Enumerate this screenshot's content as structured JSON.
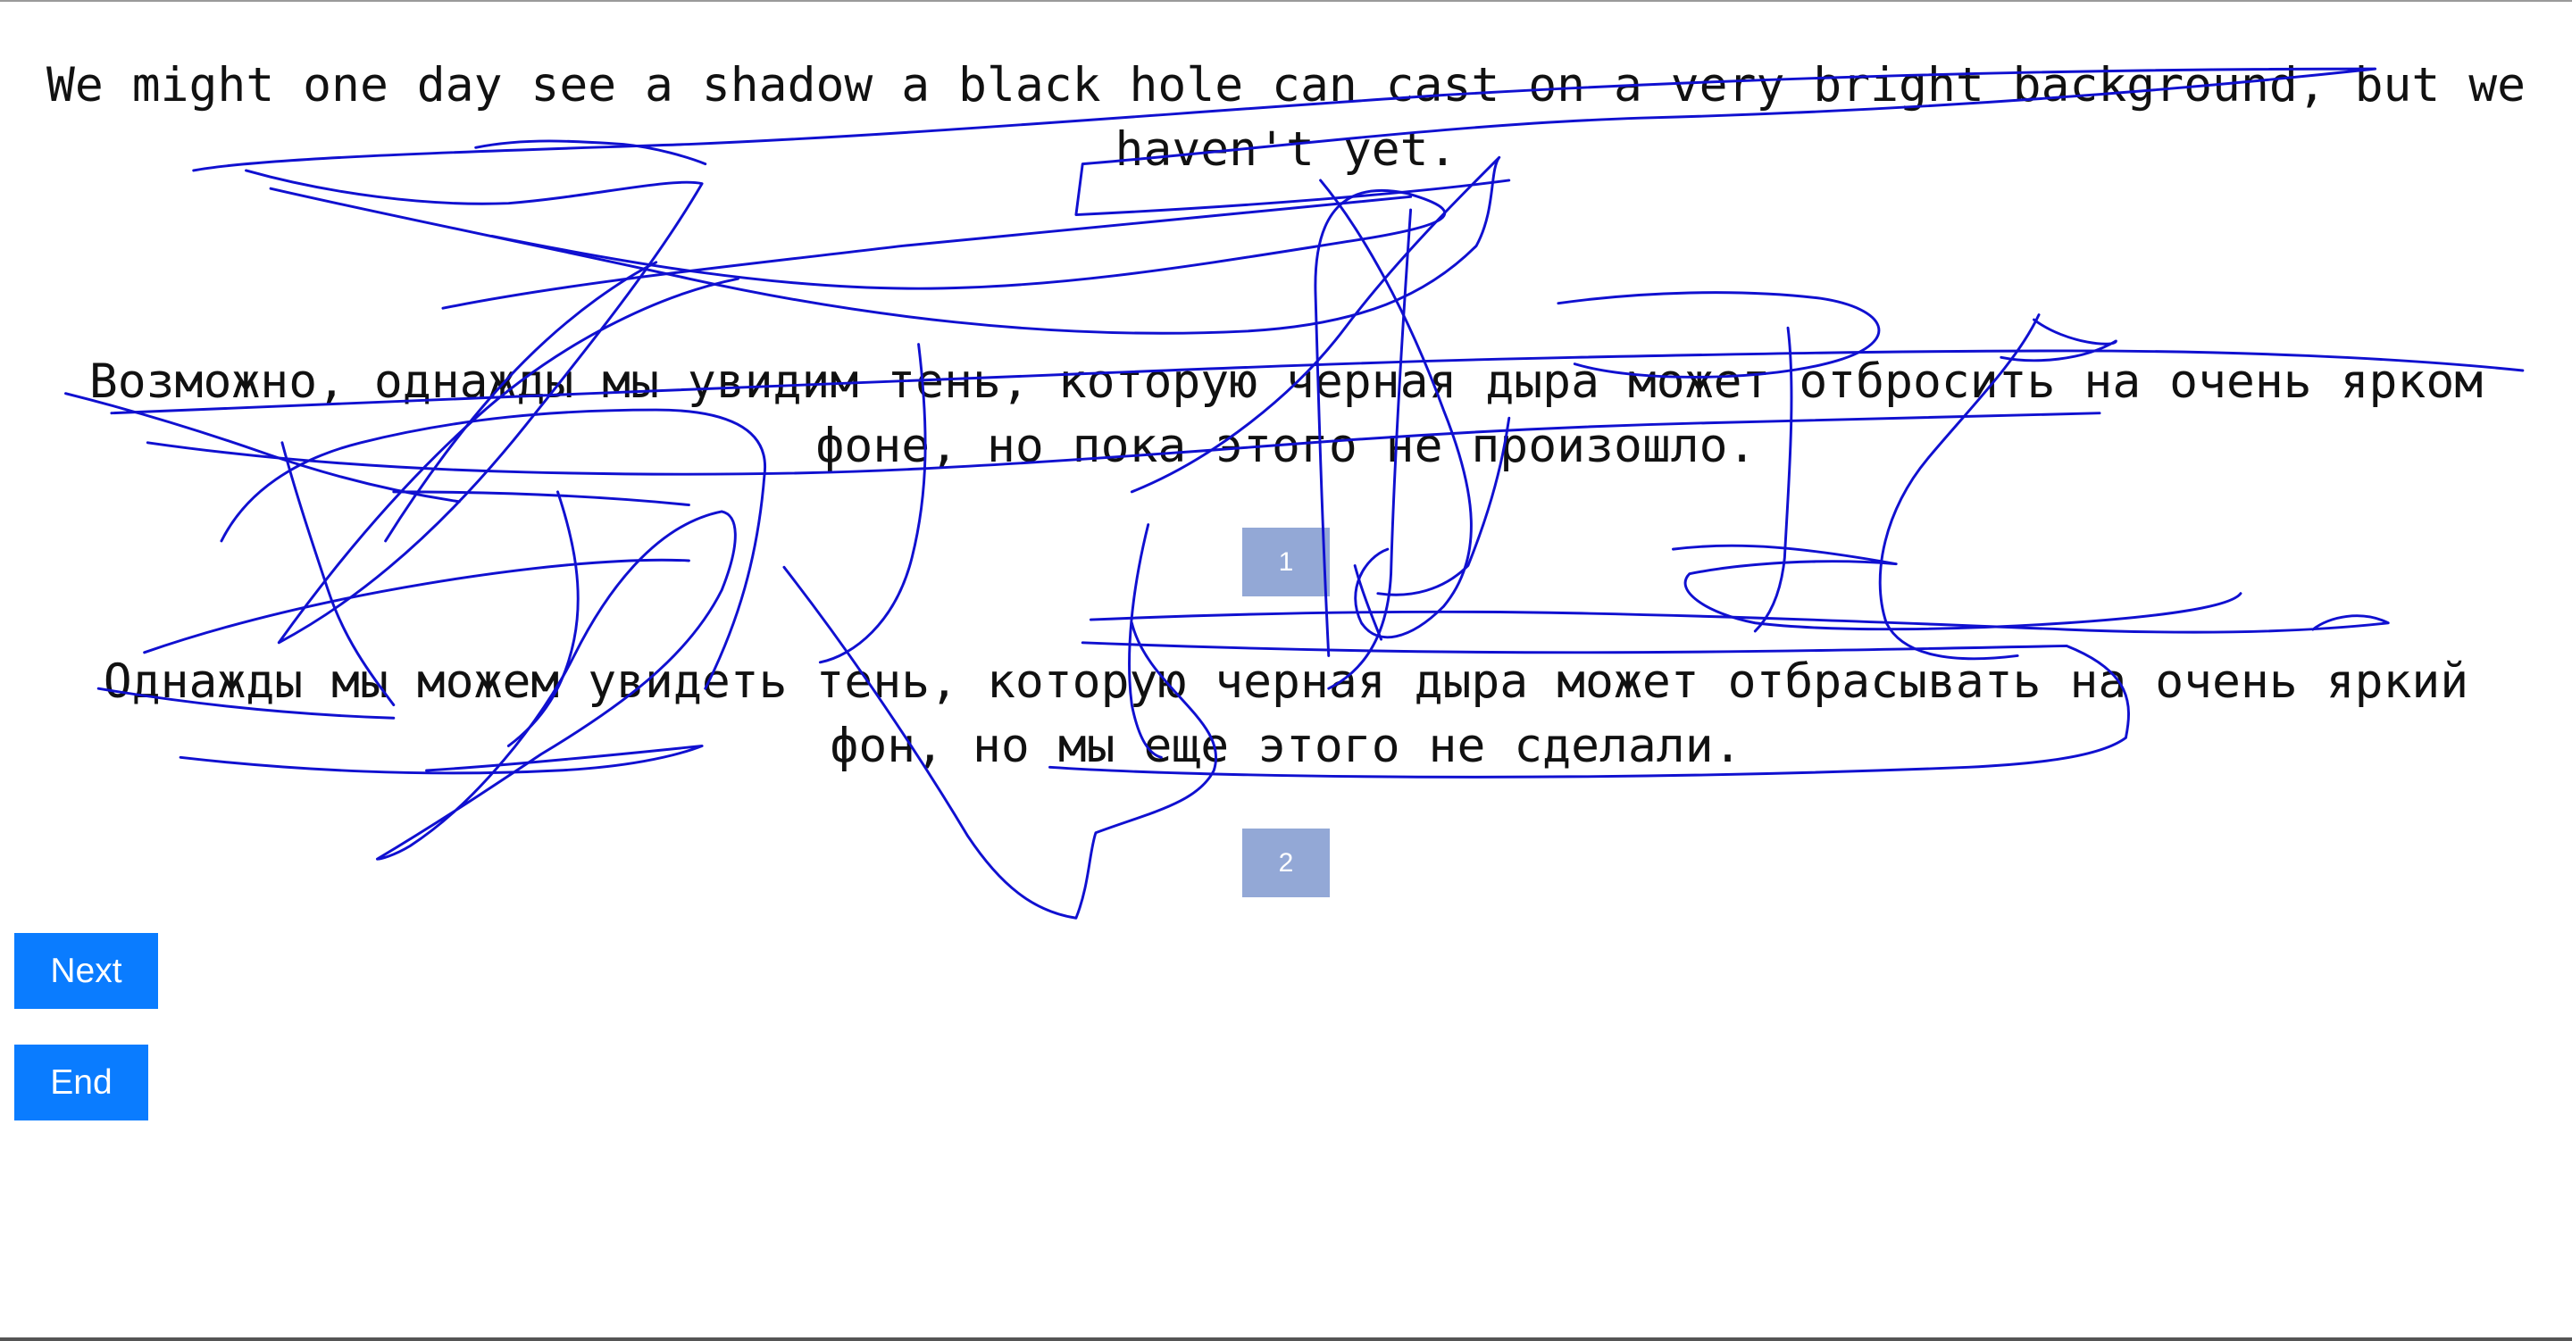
{
  "sentences": [
    "We might one day see a shadow a black hole can cast on a very bright background, but we haven't yet.",
    "Возможно, однажды мы увидим тень, которую черная дыра может отбросить на очень ярком фоне, но пока этого не произошло.",
    "Однажды мы можем увидеть тень, которую черная дыра может отбрасывать на очень яркий фон, но мы еще этого не сделали."
  ],
  "markers": [
    "1",
    "2"
  ],
  "buttons": {
    "next": "Next",
    "end": "End"
  },
  "colors": {
    "button": "#0a7cff",
    "marker": "#93a8d6",
    "scribble": "#1010d0"
  }
}
